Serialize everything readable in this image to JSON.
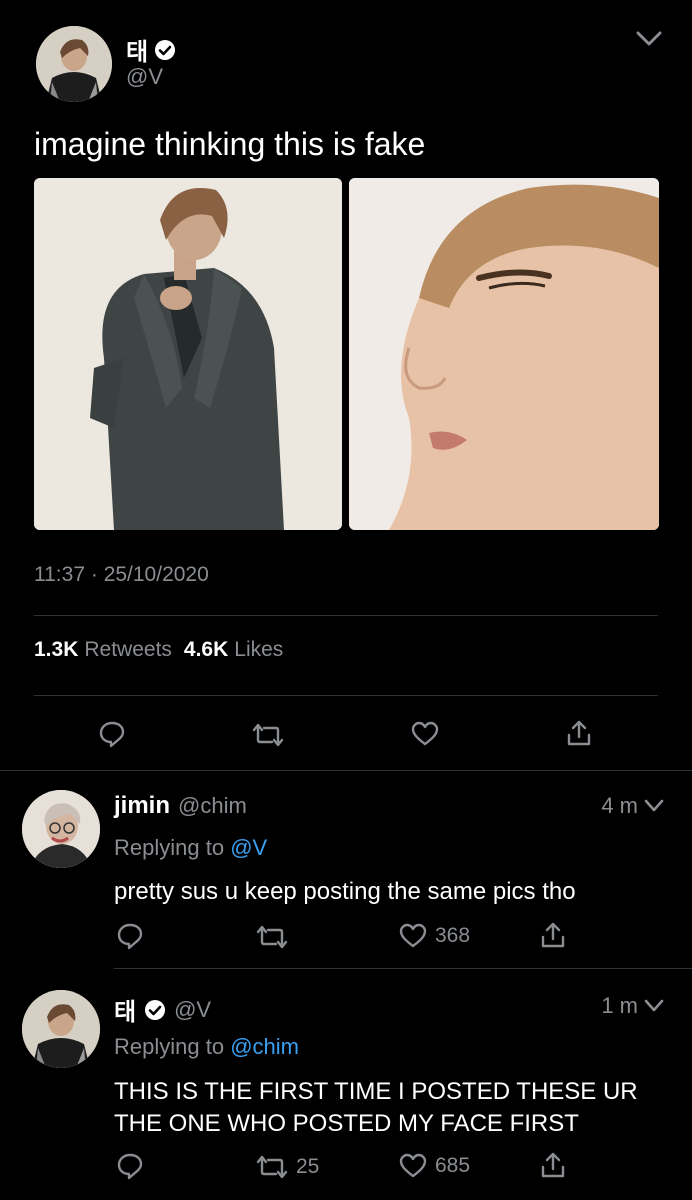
{
  "main_tweet": {
    "display_name": "태",
    "handle": "@V",
    "text": "imagine thinking this is fake",
    "time": "11:37",
    "separator": "·",
    "date": "25/10/2020",
    "retweets_count": "1.3K",
    "retweets_label": "Retweets",
    "likes_count": "4.6K",
    "likes_label": "Likes"
  },
  "replies": [
    {
      "display_name": "jimin",
      "handle": "@chim",
      "age": "4 m",
      "replying_prefix": "Replying to",
      "replying_to": "@V",
      "text": "pretty sus u keep posting the same pics tho",
      "retweets": "",
      "likes": "368"
    },
    {
      "display_name": "태",
      "handle": "@V",
      "age": "1 m",
      "replying_prefix": "Replying to",
      "replying_to": "@chim",
      "text_line1": "THIS IS THE FIRST TIME I POSTED THESE UR",
      "text_line2": "THE ONE WHO POSTED MY FACE FIRST",
      "retweets": "25",
      "likes": "685"
    }
  ],
  "colors": {
    "background": "#000000",
    "link": "#3a9ff0",
    "muted": "#8a8d91",
    "divider": "#2f3336"
  }
}
